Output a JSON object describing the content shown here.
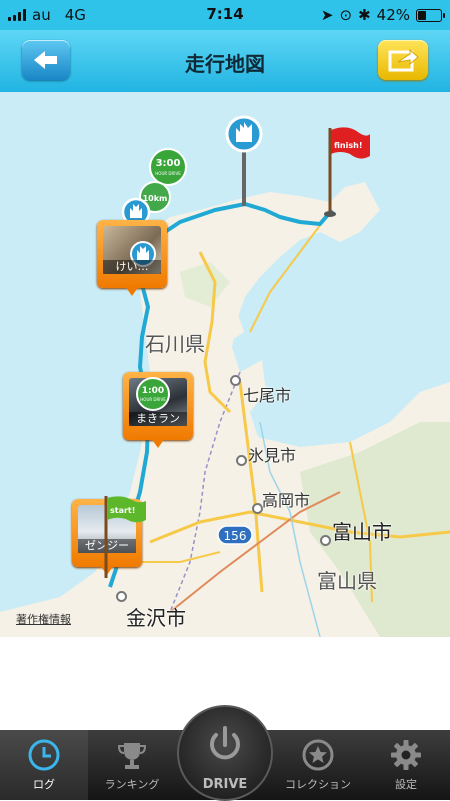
{
  "status_bar": {
    "carrier": "au",
    "network": "4G",
    "time": "7:14",
    "battery": "42%",
    "battery_level": 0.42
  },
  "nav_bar": {
    "title": "走行地図",
    "back_icon": "arrow-left-icon",
    "share_icon": "share-arrow-icon"
  },
  "map": {
    "labels": {
      "ishikawa_pref": "石川県",
      "nanao": "七尾市",
      "himi": "氷見市",
      "takaoka": "高岡市",
      "toyama_city": "富山市",
      "toyama_pref": "富山県",
      "kanazawa": "金沢市",
      "route_shield": "156"
    },
    "copyright": "著作権情報",
    "flags": {
      "start": "start!",
      "finish": "finish!"
    },
    "badges": {
      "three_hour": "3:00",
      "three_hour_sub": "HOUR DRIVE",
      "one_hour": "1:00",
      "one_hour_sub": "HOUR DRIVE",
      "km_badge": "10km"
    },
    "photo_pins": [
      {
        "caption": "けい…"
      },
      {
        "caption": "まきラン"
      },
      {
        "caption": "ゼンジー"
      }
    ],
    "colors": {
      "route": "#21a9d6",
      "land": "#f5f1e6",
      "water": "#c9ecf7",
      "pin": "#f07a00"
    }
  },
  "tab_bar": {
    "tabs": [
      {
        "label": "ログ",
        "icon": "clock-icon",
        "active": true
      },
      {
        "label": "ランキング",
        "icon": "trophy-icon",
        "active": false
      },
      {
        "label": "DRIVE",
        "icon": "power-icon",
        "active": false
      },
      {
        "label": "コレクション",
        "icon": "star-badge-icon",
        "active": false
      },
      {
        "label": "設定",
        "icon": "gear-icon",
        "active": false
      }
    ]
  }
}
